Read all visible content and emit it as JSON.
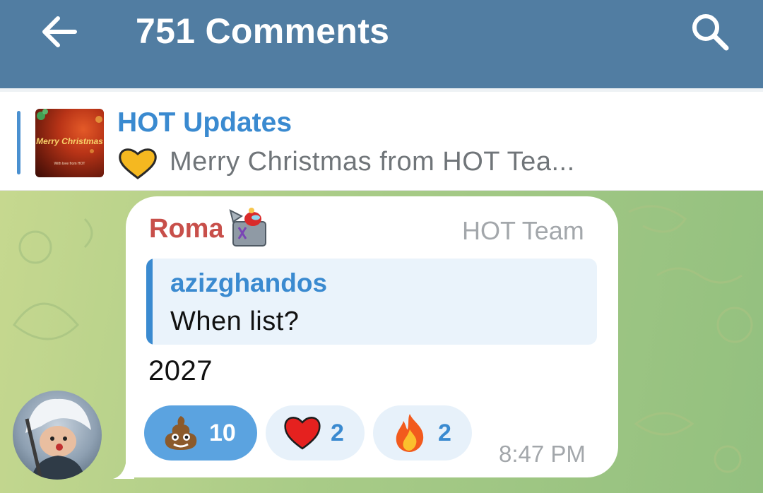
{
  "header": {
    "title": "751 Comments",
    "back_icon": "arrow-left-icon",
    "search_icon": "search-icon",
    "color": "#517da2"
  },
  "pinned": {
    "channel": "HOT Updates",
    "emoji": "yellow-heart-icon",
    "message": "Merry Christmas from HOT Tea...",
    "thumb_title": "Merry Christmas",
    "thumb_sub": "With love from HOT"
  },
  "comment": {
    "sender": "Roma",
    "sender_emoji": "jack-in-the-box-icon",
    "role": "HOT Team",
    "reply": {
      "name": "azizghandos",
      "text": "When list?"
    },
    "text": "2027",
    "time": "8:47 PM",
    "reactions": [
      {
        "emoji": "poop-icon",
        "count": "10",
        "active": true
      },
      {
        "emoji": "red-heart-icon",
        "count": "2",
        "active": false
      },
      {
        "emoji": "fire-icon",
        "count": "2",
        "active": false
      }
    ]
  },
  "colors": {
    "accent": "#3a8ad0",
    "sender": "#c84f4a",
    "reaction_active": "#5ba3e0"
  }
}
